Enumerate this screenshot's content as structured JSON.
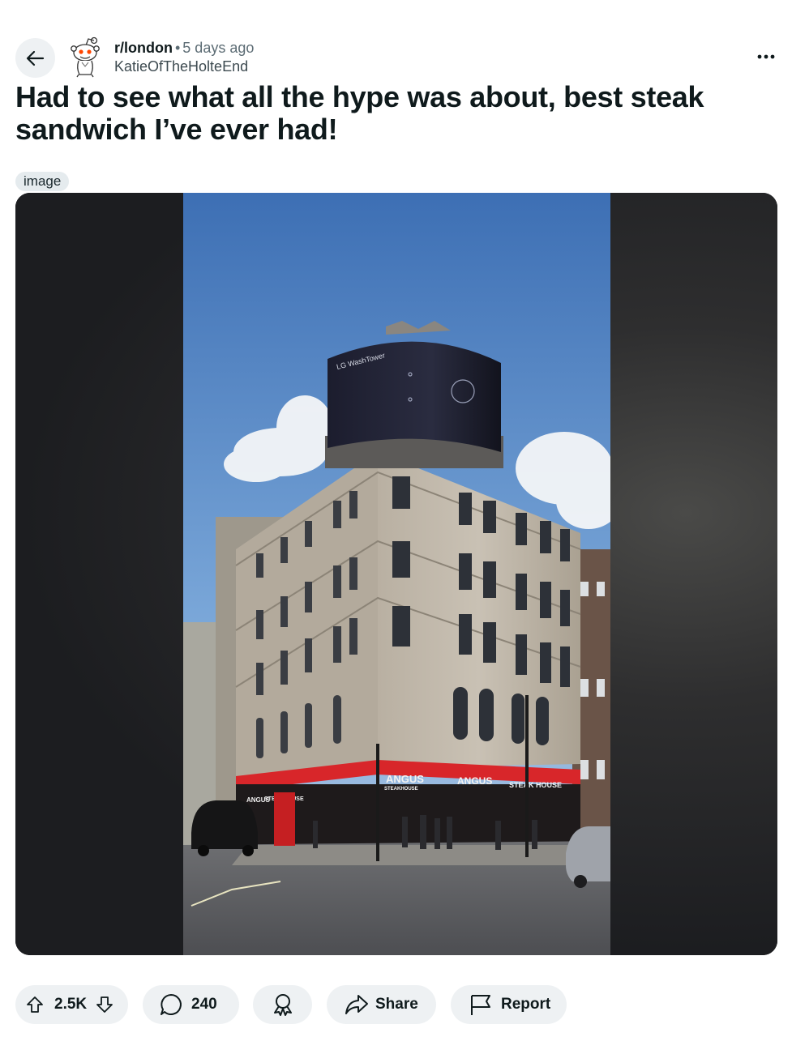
{
  "post": {
    "subreddit": "r/london",
    "separator": "•",
    "time_ago": "5 days ago",
    "author": "KatieOfTheHolteEnd",
    "title": "Had to see what all the hype was about, best steak sandwich I’ve ever had!",
    "flair": "image"
  },
  "photo": {
    "billboard_text": "LG WashTower",
    "shop_signs": [
      "ANGUS",
      "STEAKHOUSE",
      "ANGUS",
      "STEAKHOUSE",
      "ANGUS",
      "STEAK HOUSE"
    ]
  },
  "actions": {
    "vote_count": "2.5K",
    "comment_count": "240",
    "share_label": "Share",
    "report_label": "Report"
  },
  "icons": {
    "back": "arrow-left-icon",
    "more": "more-horizontal-icon",
    "upvote": "upvote-arrow-icon",
    "downvote": "downvote-arrow-icon",
    "comment": "comment-bubble-icon",
    "award": "award-icon",
    "share": "share-arrow-icon",
    "report": "flag-icon"
  },
  "colors": {
    "pill_bg": "#eef1f3",
    "text": "#0f1a1c",
    "muted": "#5c6c74",
    "snoo_orange": "#ff4500"
  }
}
